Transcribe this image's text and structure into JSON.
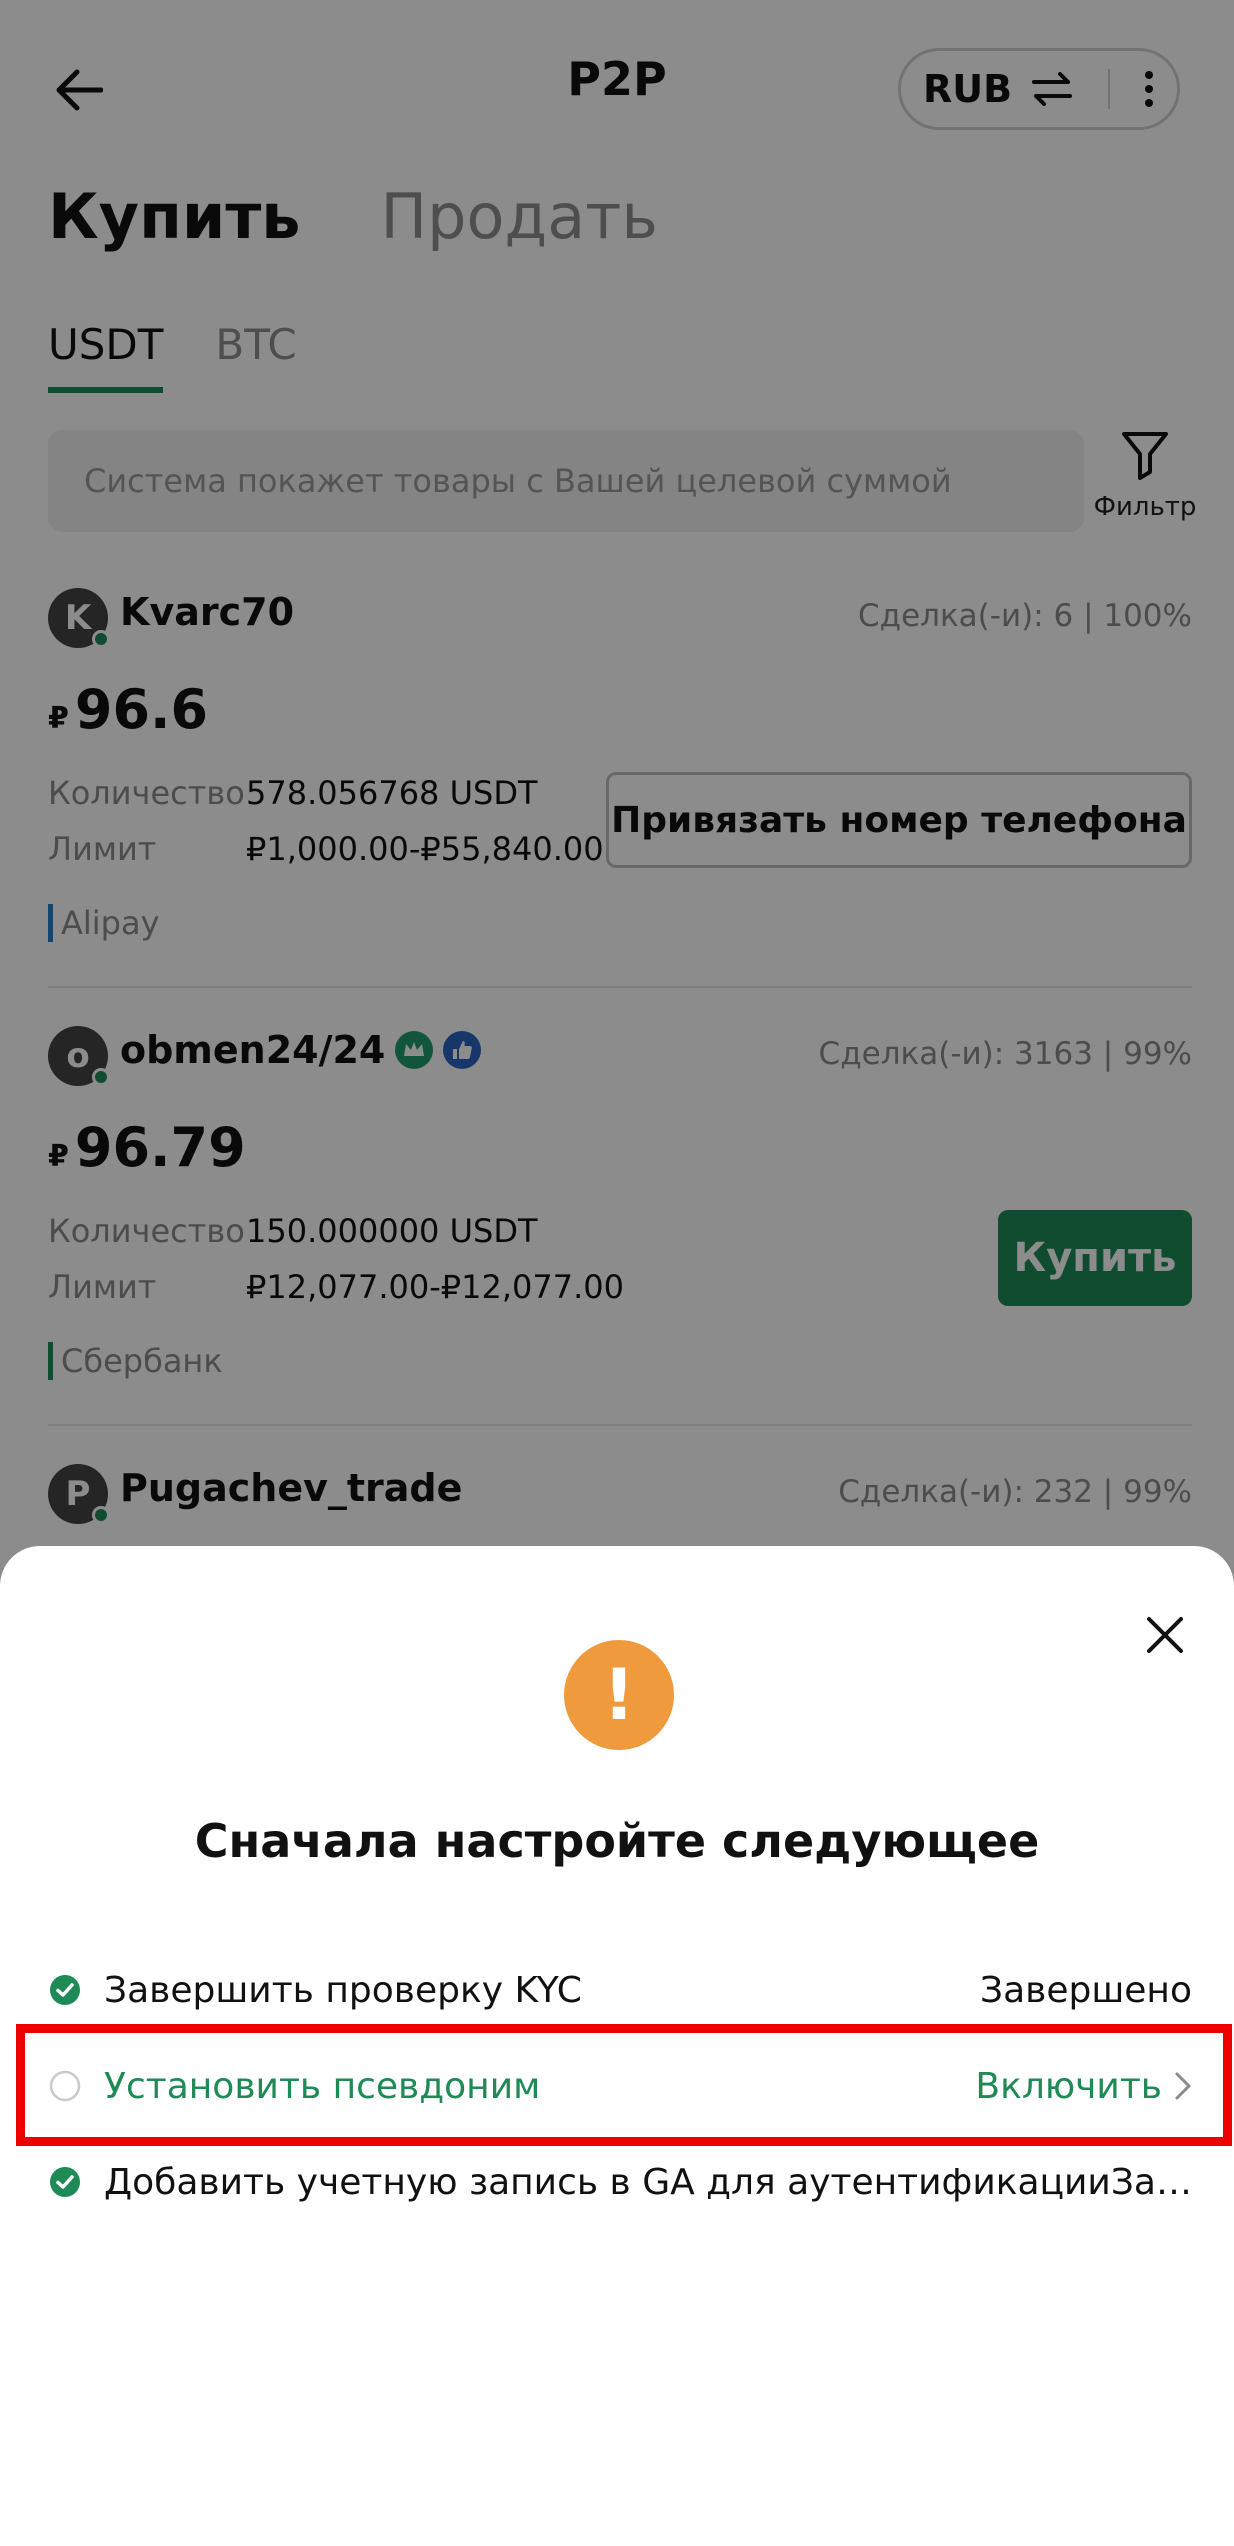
{
  "header": {
    "title": "P2P",
    "currency": "RUB"
  },
  "main_tabs": {
    "buy": "Купить",
    "sell": "Продать"
  },
  "coin_tabs": {
    "usdt": "USDT",
    "btc": "BTC"
  },
  "search": {
    "placeholder": "Система покажет товары с Вашей целевой суммой"
  },
  "filter": {
    "label": "Фильтр"
  },
  "offers": [
    {
      "avatar": "K",
      "trader": "Kvarc70",
      "deals": "Сделка(-и): 6 | 100%",
      "currency_sign": "₽",
      "price": "96.6",
      "qty_label": "Количество",
      "qty": "578.056768 USDT",
      "limit_label": "Лимит",
      "limit": "₽1,000.00-₽55,840.00",
      "payment": "Alipay",
      "action": "Привязать номер телефона"
    },
    {
      "avatar": "o",
      "trader": "obmen24/24",
      "deals": "Сделка(-и): 3163 | 99%",
      "currency_sign": "₽",
      "price": "96.79",
      "qty_label": "Количество",
      "qty": "150.000000 USDT",
      "limit_label": "Лимит",
      "limit": "₽12,077.00-₽12,077.00",
      "payment": "Сбербанк",
      "action": "Купить"
    },
    {
      "avatar": "P",
      "trader": "Pugachev_trade",
      "deals": "Сделка(-и): 232 | 99%"
    }
  ],
  "sheet": {
    "title": "Сначала настройте следующее",
    "tasks": [
      {
        "label": "Завершить проверку KYC",
        "status": "Завершено"
      },
      {
        "label": "Установить псевдоним",
        "status": "Включить"
      },
      {
        "label": "Добавить учетную запись в GA для аутентификацииЗаве…"
      }
    ]
  },
  "colors": {
    "accent": "#1e8a56",
    "warning": "#ef9a3c",
    "highlight": "#ee0000"
  }
}
